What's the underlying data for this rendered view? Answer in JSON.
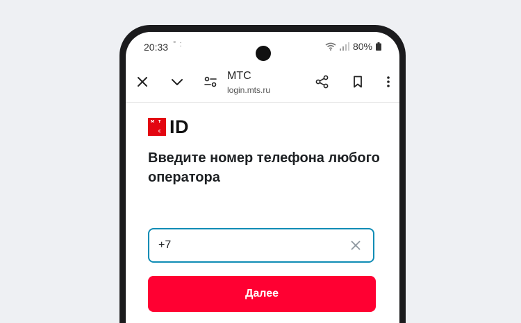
{
  "status_bar": {
    "time": "20:33",
    "notification_glyphs": "° :",
    "battery_percent": "80%"
  },
  "browser": {
    "site_title": "МТС",
    "site_url": "login.mts.ru",
    "icons": [
      "close-icon",
      "chevron-down-icon",
      "site-settings-icon",
      "share-icon",
      "bookmark-icon",
      "more-vertical-icon"
    ]
  },
  "brand": {
    "logo_letters": [
      "М",
      "Т",
      "С"
    ],
    "logo_text": "ID",
    "logo_color": "#e30611"
  },
  "login": {
    "heading": "Введите номер телефона любого оператора",
    "phone_value": "+7",
    "submit_label": "Далее",
    "accent_color": "#ff0032",
    "input_border_color": "#0f8cb5"
  }
}
